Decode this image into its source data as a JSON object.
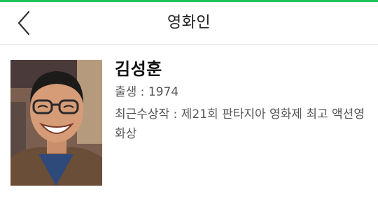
{
  "header": {
    "title": "영화인",
    "back_icon": "chevron-left-icon",
    "accent_color": "#21c35a"
  },
  "person": {
    "name": "김성훈",
    "birth_label": "출생 : ",
    "birth_value": "1974",
    "award_label": "최근수상작 : ",
    "award_value": "제21회 판타지아 영화제 최고 액션영화상"
  }
}
